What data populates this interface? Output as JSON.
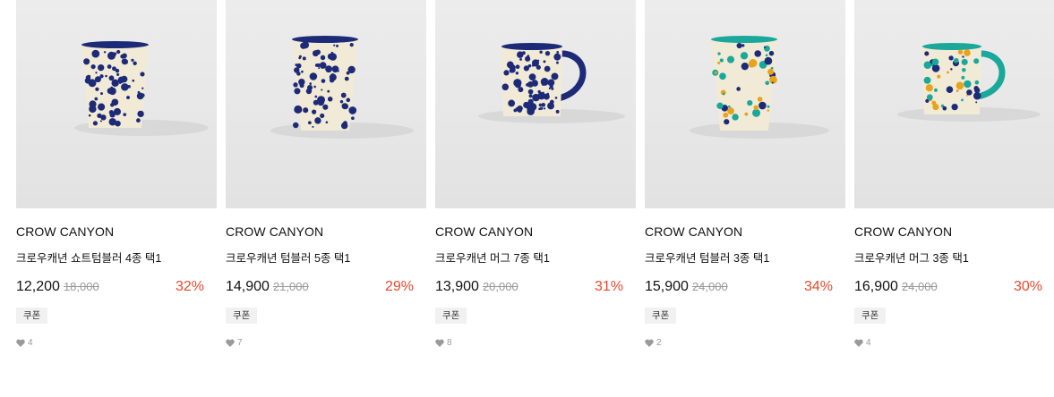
{
  "products": [
    {
      "brand": "CROW CANYON",
      "title": "크로우캐년 쇼트텀블러 4종 택1",
      "price": "12,200",
      "original_price": "18,000",
      "discount": "32%",
      "coupon": "쿠폰",
      "likes": "4",
      "image_icon": "short-tumbler-navy-splatter",
      "colors": [
        "#1d2a78",
        "#f1ead6"
      ]
    },
    {
      "brand": "CROW CANYON",
      "title": "크로우캐년 텀블러 5종 택1",
      "price": "14,900",
      "original_price": "21,000",
      "discount": "29%",
      "coupon": "쿠폰",
      "likes": "7",
      "image_icon": "tumbler-navy-splatter",
      "colors": [
        "#1d2a78",
        "#f1ead6"
      ]
    },
    {
      "brand": "CROW CANYON",
      "title": "크로우캐년 머그 7종 택1",
      "price": "13,900",
      "original_price": "20,000",
      "discount": "31%",
      "coupon": "쿠폰",
      "likes": "8",
      "image_icon": "mug-navy-splatter",
      "colors": [
        "#1d2a78",
        "#f1ead6"
      ]
    },
    {
      "brand": "CROW CANYON",
      "title": "크로우캐년 텀블러 3종 택1",
      "price": "15,900",
      "original_price": "24,000",
      "discount": "34%",
      "coupon": "쿠폰",
      "likes": "2",
      "image_icon": "tumbler-multicolor-splatter",
      "colors": [
        "#1aa89a",
        "#e8a21c",
        "#1d2a78",
        "#f1ead6"
      ]
    },
    {
      "brand": "CROW CANYON",
      "title": "크로우캐년 머그 3종 택1",
      "price": "16,900",
      "original_price": "24,000",
      "discount": "30%",
      "coupon": "쿠폰",
      "likes": "4",
      "image_icon": "mug-multicolor-splatter",
      "colors": [
        "#1aa89a",
        "#e8a21c",
        "#1d2a78",
        "#f1ead6"
      ]
    }
  ],
  "accent_color": "#e8492d"
}
